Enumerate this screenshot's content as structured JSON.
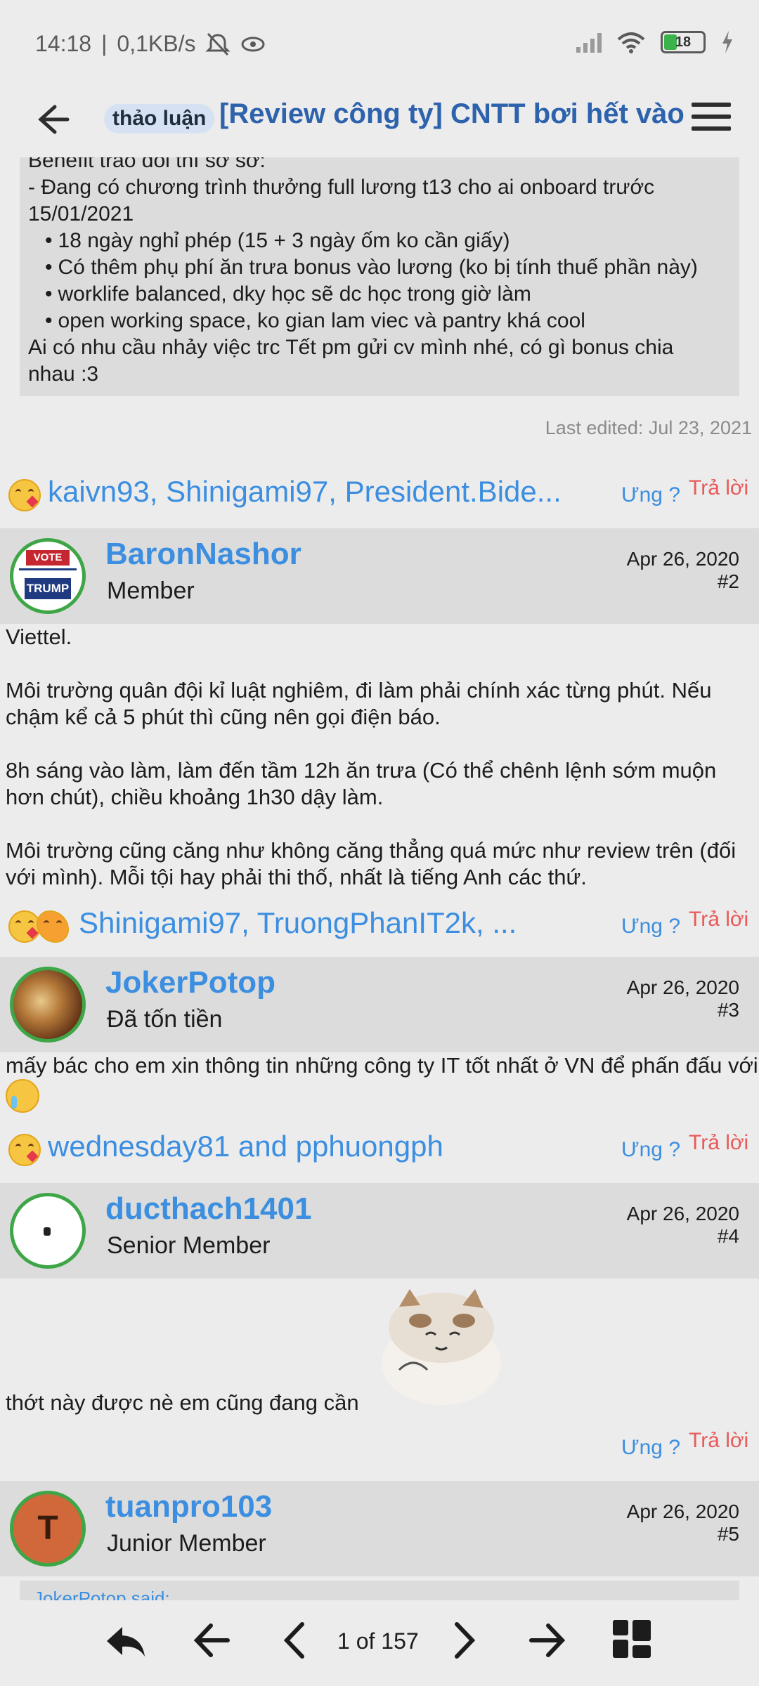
{
  "status_bar": {
    "time": "14:18",
    "net_speed": "0,1KB/s",
    "battery_level": "18"
  },
  "header": {
    "prefix": "thảo luận",
    "title": "[Review công ty] CNTT bơi hết vào"
  },
  "post1": {
    "lines": [
      "Benefit trao đổi thì sơ sơ:",
      "- Đang có chương trình thưởng full lương t13 cho ai onboard trước",
      "15/01/2021"
    ],
    "bullets": [
      "18 ngày nghỉ phép (15 + 3 ngày ốm ko cần giấy)",
      "Có thêm phụ phí ăn trưa bonus vào lương (ko bị tính thuế phần này)",
      "worklife balanced, dky học sẽ dc học trong giờ làm",
      "open working space, ko gian lam viec và pantry khá cool"
    ],
    "closing": [
      "Ai có nhu cầu nhảy việc trc Tết pm gửi cv mình nhé, có gì bonus chia",
      "nhau :3"
    ],
    "last_edited": "Last edited: Jul 23, 2021",
    "reactions": "kaivn93, Shinigami97, President.Bide..."
  },
  "actions": {
    "react": "Ưng ?",
    "reply": "Trả lời"
  },
  "post2": {
    "username": "BaronNashor",
    "role": "Member",
    "date": "Apr 26, 2020",
    "number": "#2",
    "avatar_top": "VOTE",
    "avatar_bottom": "TRUMP",
    "paragraphs": [
      [
        "Viettel."
      ],
      [
        "Môi trường quân đội kỉ luật nghiêm, đi làm phải chính xác từng phút. Nếu",
        "chậm kể cả 5 phút thì cũng nên gọi điện báo."
      ],
      [
        "8h sáng vào làm, làm đến tầm 12h ăn trưa (Có thể chênh lệnh sớm muộn",
        "hơn chút), chiều khoảng 1h30 dậy làm."
      ],
      [
        "Môi trường cũng căng như không căng thẳng quá mức như review trên (đối",
        "với mình). Mỗi tội hay phải thi thố, nhất là tiếng Anh các thứ."
      ]
    ],
    "reactions": "Shinigami97, TruongPhanIT2k, ..."
  },
  "post3": {
    "username": "JokerPotop",
    "role": "Đã tốn tiền",
    "date": "Apr 26, 2020",
    "number": "#3",
    "body": "mấy bác cho em xin thông tin những công ty IT tốt nhất ở VN để phấn đấu với",
    "reactions": "wednesday81 and pphuongph"
  },
  "post4": {
    "username": "ducthach1401",
    "role": "Senior Member",
    "date": "Apr 26, 2020",
    "number": "#4",
    "body": "thớt này được nè em cũng đang cần"
  },
  "post5": {
    "username": "tuanpro103",
    "role": "Junior Member",
    "date": "Apr 26, 2020",
    "number": "#5",
    "avatar_letter": "T",
    "quote_peek": "JokerPotop said:"
  },
  "pagination": {
    "current": "1 of 157"
  },
  "colors": {
    "link_blue": "#3b8ee0",
    "title_blue": "#2d62ad",
    "reply_red": "#e85a5a",
    "avatar_border_green": "#3ea647"
  }
}
